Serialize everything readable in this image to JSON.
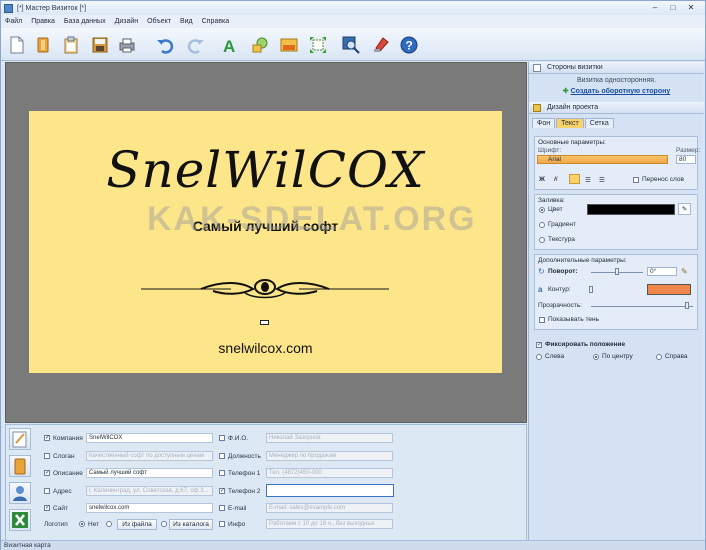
{
  "window": {
    "title": "[*] Мастер Визиток [*]",
    "controls": [
      "–",
      "□",
      "✕"
    ]
  },
  "menu": [
    "Файл",
    "Правка",
    "База данных",
    "Дизайн",
    "Объект",
    "Вид",
    "Справка"
  ],
  "toolbar": {
    "icons": [
      "new-document-icon",
      "open-folder-icon",
      "clipboard-icon",
      "save-icon",
      "print-icon",
      "undo-icon",
      "redo-icon",
      "text-icon",
      "shapes-icon",
      "image-icon",
      "fit-icon",
      "zoom-icon",
      "paint-icon",
      "help-icon"
    ]
  },
  "card": {
    "company": "SnelWilCOX",
    "slogan": "Самый лучший софт",
    "website": "snelwilcox.com",
    "background": "#fde68a"
  },
  "watermark": "KAK-SDELAT.ORG",
  "sides": {
    "header": "Стороны визитки",
    "status": "Визитка односторонняя.",
    "link": "Создать оборотную сторону"
  },
  "design": {
    "header": "Дизайн проекта",
    "tabs": [
      "Фон",
      "Текст",
      "Сетка"
    ],
    "active_tab": "Текст",
    "basic": {
      "title": "Основные параметры:",
      "font_label": "Шрифт:",
      "font_value": "Arial",
      "size_label": "Размер:",
      "size_value": "80",
      "wrap_label": "Перенос слов"
    },
    "fill": {
      "title": "Заливка:",
      "options": [
        "Цвет",
        "Градиент",
        "Текстура"
      ],
      "selected": "Цвет",
      "color": "#000000"
    },
    "extra": {
      "title": "Дополнительные параметры:",
      "rotation_label": "Поворот:",
      "rotation_value": "0°",
      "outline_label": "Контур:",
      "outline_color": "#f0874a",
      "opacity_label": "Прозрачность:",
      "shadow_label": "Показывать тень"
    },
    "fix": {
      "label": "Фиксировать положение",
      "options": [
        "Слева",
        "По центру",
        "Справа"
      ],
      "selected": "По центру"
    }
  },
  "fields": {
    "company": {
      "label": "Компания",
      "value": "SnelWilCOX"
    },
    "slogan": {
      "label": "Слоган",
      "value": "Качественный софт по доступным ценам"
    },
    "description": {
      "label": "Описание",
      "value": "Самый лучший софт"
    },
    "address": {
      "label": "Адрес",
      "value": "г. Калининград, ул. Советская, д.67, оф.3..."
    },
    "site": {
      "label": "Сайт",
      "value": "snelwilcox.com"
    },
    "logo": {
      "label": "Логотип",
      "no": "Нет",
      "from_file": "Из файла",
      "from_catalog": "Из каталога"
    },
    "fio": {
      "label": "Ф.И.О.",
      "value": "Николай Зазорнов"
    },
    "position": {
      "label": "Должность",
      "value": "Менеджер по продажам"
    },
    "phone1": {
      "label": "Телефон 1",
      "value": "Тел. (4872)450-000"
    },
    "phone2": {
      "label": "Телефон 2",
      "value": ""
    },
    "email": {
      "label": "E-mail",
      "value": "E-mail: sales@example.com"
    },
    "info": {
      "label": "Инфо",
      "value": "Работаем с 10 до 18 ч., без выходных"
    }
  },
  "status": "Визитная карта"
}
